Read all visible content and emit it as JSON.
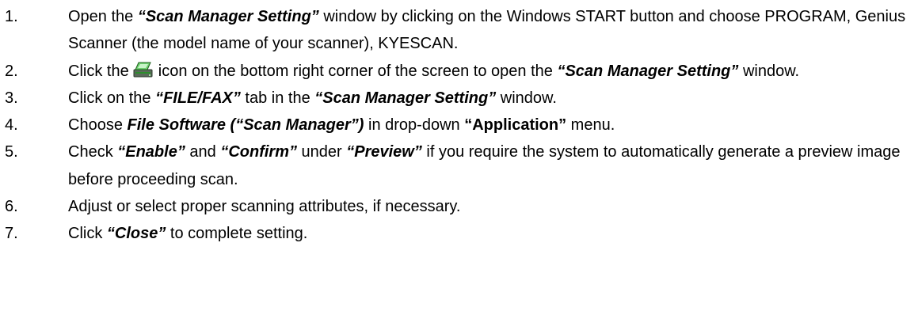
{
  "steps": [
    {
      "num": "1.",
      "t1": "Open the ",
      "b1": "“Scan Manager Setting”",
      "t2": " window by clicking on the Windows START button and choose PROGRAM, Genius Scanner (the model name of your scanner), KYESCAN."
    },
    {
      "num": "2.",
      "t1": "Click the ",
      "icon": "scanner-tray-icon",
      "t2": " icon on the bottom right corner of the screen to open the ",
      "b1": "“Scan Manager Setting”",
      "t3": " window."
    },
    {
      "num": "3.",
      "t1": "Click on the ",
      "b1": "“FILE/FAX”",
      "t2": " tab in the ",
      "b2": "“Scan Manager Setting”",
      "t3": " window."
    },
    {
      "num": "4.",
      "t1": "Choose ",
      "b1": "File Software (“Scan Manager”)",
      "t2": " in drop-down ",
      "b2": "“Application”",
      "t3": " menu."
    },
    {
      "num": "5.",
      "t1": "Check ",
      "b1": "“Enable”",
      "t2": " and ",
      "b2": "“Confirm”",
      "t3": " under ",
      "b3": "“Preview”",
      "t4": " if you require the system to automatically generate a preview image before proceeding scan."
    },
    {
      "num": "6.",
      "t1": "Adjust or select proper scanning attributes, if necessary."
    },
    {
      "num": "7.",
      "t1": "Click ",
      "b1": "“Close”",
      "t2": " to complete setting."
    }
  ]
}
